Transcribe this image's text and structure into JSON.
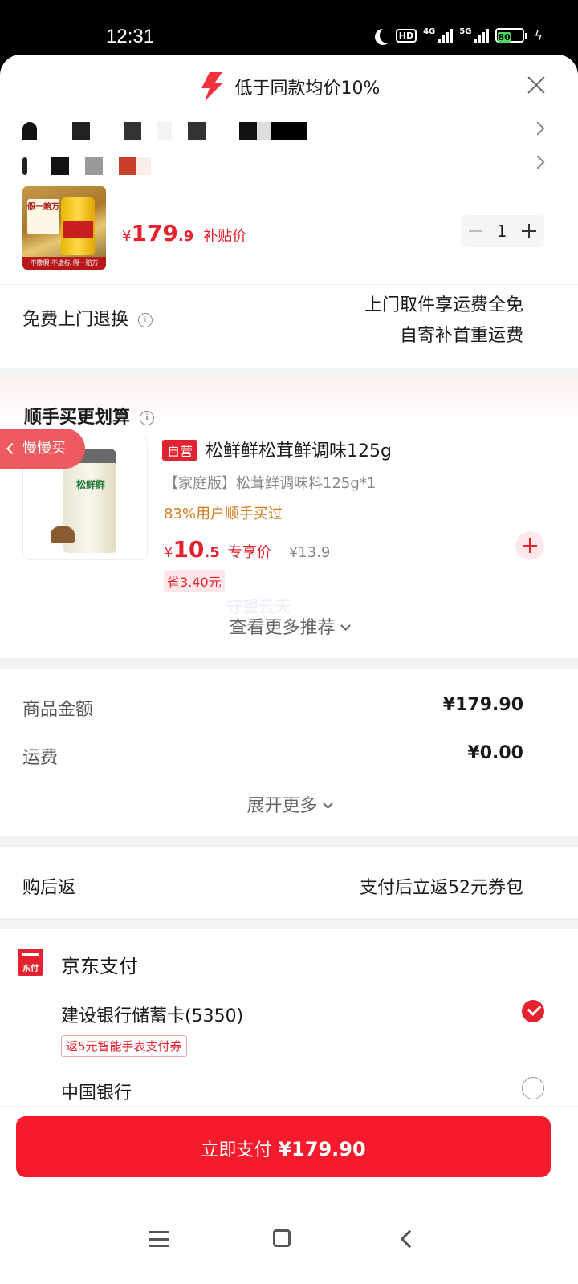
{
  "status_bar": {
    "time": "12:31",
    "network_1": "4G",
    "network_2": "5G",
    "hd_badge": "HD",
    "battery": "80"
  },
  "banner": {
    "text": "低于同款均价10%"
  },
  "product": {
    "price_currency": "¥",
    "price_int": "179",
    "price_dec": ".9",
    "price_label": "补贴价",
    "quantity": "1",
    "thumb_tag": "假一赔万",
    "thumb_footer": "不掺假 不虚标 假一赔万"
  },
  "return_service": {
    "label": "免费上门退换",
    "line1": "上门取件享运费全免",
    "line2": "自寄补首重运费"
  },
  "recommend": {
    "title": "顺手买更划算",
    "slow_buy": "慢慢买",
    "self_tag": "自营",
    "name": "松鲜鲜松茸鲜调味125g",
    "spec": "【家庭版】松茸鲜调味料125g*1",
    "users": "83%用户顺手买过",
    "price_currency": "¥",
    "price_int": "10",
    "price_dec": ".5",
    "price_label": "专享价",
    "orig_price": "¥13.9",
    "save": "省3.40元",
    "jar_brand": "松鲜鲜",
    "watermark": "守望云天",
    "more": "查看更多推荐"
  },
  "summary": {
    "goods_label": "商品金额",
    "goods_value": "¥179.90",
    "shipping_label": "运费",
    "shipping_value": "¥0.00",
    "expand": "展开更多"
  },
  "cashback": {
    "label": "购后返",
    "value": "支付后立返52元券包"
  },
  "payment": {
    "logo_text": "东付",
    "title": "京东支付",
    "bank1": "建设银行储蓄卡(5350)",
    "coupon": "返5元智能手表支付券",
    "bank2": "中国银行"
  },
  "pay_button": {
    "label": "立即支付",
    "amount": "¥179.90"
  },
  "colors": {
    "accent": "#e4222f",
    "pay_button": "#f51a2c",
    "orange": "#d17b1a"
  }
}
